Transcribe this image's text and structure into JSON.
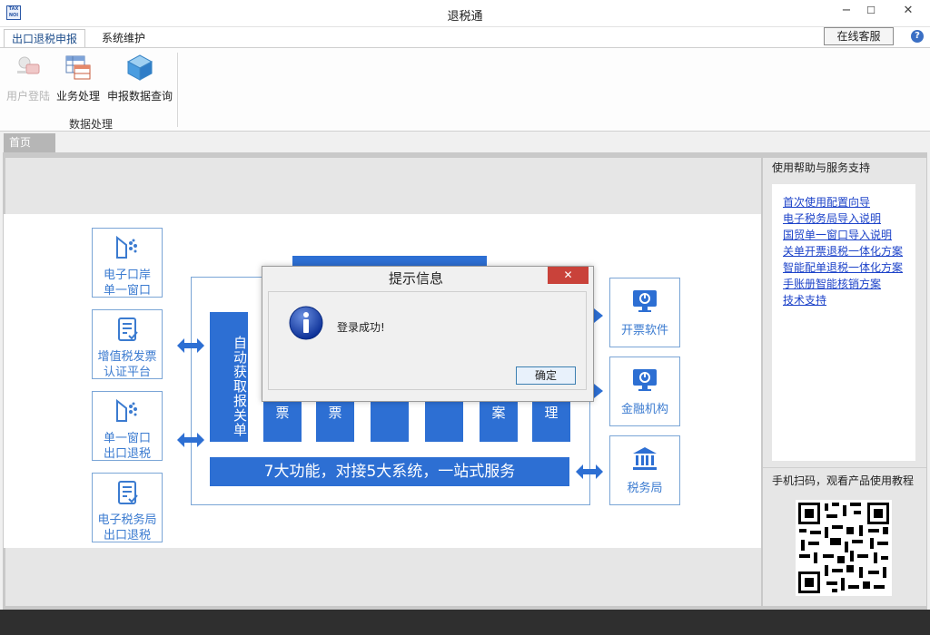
{
  "window": {
    "icon_text_top": "TAX",
    "icon_text_bottom": "NOI",
    "title": "退税通",
    "minimize": "−",
    "maximize": "☐",
    "close": "✕"
  },
  "menu": {
    "tabs": [
      "出口退税申报",
      "系统维护"
    ],
    "online_service": "在线客服",
    "help": "?"
  },
  "ribbon": {
    "buttons": [
      {
        "label": "用户登陆",
        "icon": "key-lock-icon",
        "disabled": true
      },
      {
        "label": "业务处理",
        "icon": "table-grid-icon",
        "disabled": false
      },
      {
        "label": "申报数据查询",
        "icon": "cube-icon",
        "disabled": false
      }
    ],
    "group_label": "数据处理"
  },
  "doc_tab": "首页",
  "diagram": {
    "left_systems": [
      {
        "line1": "电子口岸",
        "line2": "单一窗口",
        "icon": "hand-dots-icon"
      },
      {
        "line1": "增值税发票",
        "line2": "认证平台",
        "icon": "document-check-icon"
      },
      {
        "line1": "单一窗口",
        "line2": "出口退税",
        "icon": "hand-dots-icon"
      },
      {
        "line1": "电子税务局",
        "line2": "出口退税",
        "icon": "document-check-icon"
      }
    ],
    "right_systems": [
      {
        "label": "开票软件",
        "icon": "monitor-chart-icon"
      },
      {
        "label": "金融机构",
        "icon": "monitor-chart-icon"
      },
      {
        "label": "税务局",
        "icon": "bank-building-icon"
      }
    ],
    "auto_column": "自动获取报关单",
    "columns": [
      "票",
      "票",
      "",
      "",
      "案",
      "理"
    ],
    "banner": "7大功能，对接5大系统，一站式服务"
  },
  "help": {
    "title": "使用帮助与服务支持",
    "links": [
      "首次使用配置向导",
      "电子税务局导入说明",
      "国贸单一窗口导入说明",
      "关单开票退税一体化方案",
      "智能配单退税一体化方案",
      "手账册智能核销方案",
      "技术支持"
    ],
    "qr_title": "手机扫码，观看产品使用教程"
  },
  "dialog": {
    "title": "提示信息",
    "close": "✕",
    "message": "登录成功!",
    "ok": "确定"
  },
  "colors": {
    "accent_blue": "#2d6fd3",
    "link": "#1d43c9",
    "dialog_close": "#c9423a"
  }
}
